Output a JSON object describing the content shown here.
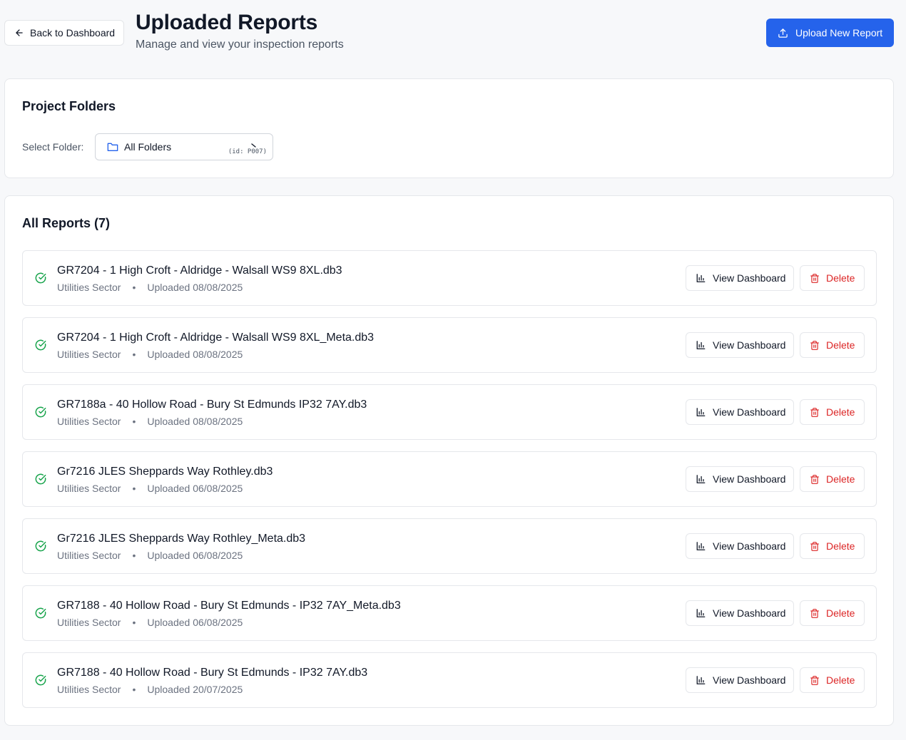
{
  "header": {
    "back_label": "Back to Dashboard",
    "title": "Uploaded Reports",
    "subtitle": "Manage and view your inspection reports",
    "upload_label": "Upload New Report"
  },
  "folders": {
    "title": "Project Folders",
    "select_label": "Select Folder:",
    "selected_value": "All Folders",
    "selected_id_hint": "(id: P007)"
  },
  "reports": {
    "title": "All Reports (7)",
    "view_label": "View Dashboard",
    "delete_label": "Delete",
    "items": [
      {
        "name": "GR7204 - 1 High Croft - Aldridge - Walsall WS9 8XL.db3",
        "sector": "Utilities Sector",
        "uploaded": "Uploaded 08/08/2025"
      },
      {
        "name": "GR7204 - 1 High Croft - Aldridge - Walsall WS9 8XL_Meta.db3",
        "sector": "Utilities Sector",
        "uploaded": "Uploaded 08/08/2025"
      },
      {
        "name": "GR7188a - 40 Hollow Road - Bury St Edmunds IP32 7AY.db3",
        "sector": "Utilities Sector",
        "uploaded": "Uploaded 08/08/2025"
      },
      {
        "name": "Gr7216 JLES Sheppards Way Rothley.db3",
        "sector": "Utilities Sector",
        "uploaded": "Uploaded 06/08/2025"
      },
      {
        "name": "Gr7216 JLES Sheppards Way Rothley_Meta.db3",
        "sector": "Utilities Sector",
        "uploaded": "Uploaded 06/08/2025"
      },
      {
        "name": "GR7188 - 40 Hollow Road - Bury St Edmunds - IP32 7AY_Meta.db3",
        "sector": "Utilities Sector",
        "uploaded": "Uploaded 06/08/2025"
      },
      {
        "name": "GR7188 - 40 Hollow Road - Bury St Edmunds - IP32 7AY.db3",
        "sector": "Utilities Sector",
        "uploaded": "Uploaded 20/07/2025"
      }
    ]
  },
  "colors": {
    "primary": "#2563eb",
    "success": "#16a34a",
    "danger": "#dc2626",
    "folder_icon": "#2563eb"
  },
  "icons": {
    "back": "arrow-left-icon",
    "upload": "upload-icon",
    "folder": "folder-icon",
    "status": "check-circle-icon",
    "view": "bar-chart-icon",
    "delete": "trash-icon"
  }
}
